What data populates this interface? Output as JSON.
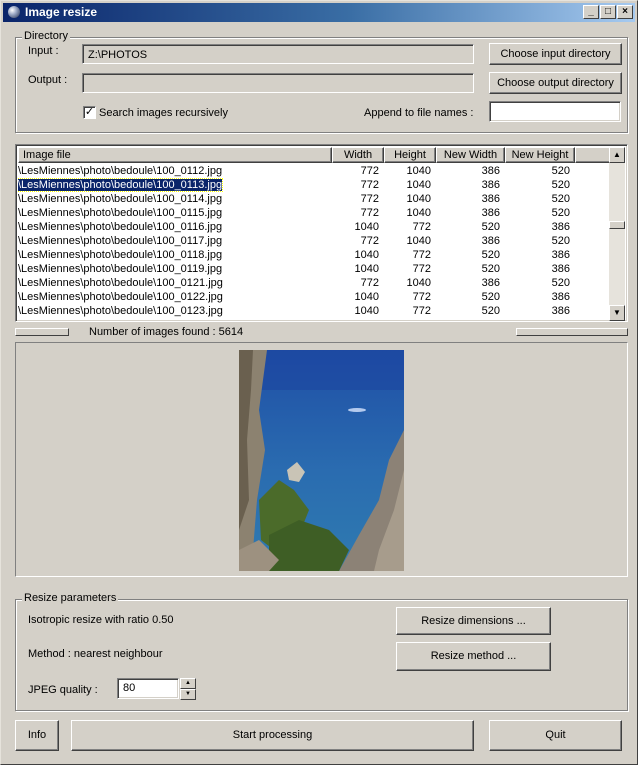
{
  "window": {
    "title": "Image resize",
    "controls": {
      "minimize": "_",
      "maximize": "□",
      "close": "×"
    }
  },
  "directory": {
    "legend": "Directory",
    "input_label": "Input :",
    "input_value": "Z:\\PHOTOS",
    "output_label": "Output :",
    "output_value": "",
    "choose_input_button": "Choose input directory",
    "choose_output_button": "Choose output directory",
    "recursive_label": "Search images recursively",
    "recursive_checked": true,
    "append_label": "Append to file names :",
    "append_value": ""
  },
  "table": {
    "columns": [
      "Image file",
      "Width",
      "Height",
      "New Width",
      "New Height"
    ],
    "rows": [
      {
        "file": "\\LesMiennes\\photo\\bedoule\\100_0112.jpg",
        "width": "772",
        "height": "1040",
        "new_width": "386",
        "new_height": "520",
        "selected": false
      },
      {
        "file": "\\LesMiennes\\photo\\bedoule\\100_0113.jpg",
        "width": "772",
        "height": "1040",
        "new_width": "386",
        "new_height": "520",
        "selected": true
      },
      {
        "file": "\\LesMiennes\\photo\\bedoule\\100_0114.jpg",
        "width": "772",
        "height": "1040",
        "new_width": "386",
        "new_height": "520",
        "selected": false
      },
      {
        "file": "\\LesMiennes\\photo\\bedoule\\100_0115.jpg",
        "width": "772",
        "height": "1040",
        "new_width": "386",
        "new_height": "520",
        "selected": false
      },
      {
        "file": "\\LesMiennes\\photo\\bedoule\\100_0116.jpg",
        "width": "1040",
        "height": "772",
        "new_width": "520",
        "new_height": "386",
        "selected": false
      },
      {
        "file": "\\LesMiennes\\photo\\bedoule\\100_0117.jpg",
        "width": "772",
        "height": "1040",
        "new_width": "386",
        "new_height": "520",
        "selected": false
      },
      {
        "file": "\\LesMiennes\\photo\\bedoule\\100_0118.jpg",
        "width": "1040",
        "height": "772",
        "new_width": "520",
        "new_height": "386",
        "selected": false
      },
      {
        "file": "\\LesMiennes\\photo\\bedoule\\100_0119.jpg",
        "width": "1040",
        "height": "772",
        "new_width": "520",
        "new_height": "386",
        "selected": false
      },
      {
        "file": "\\LesMiennes\\photo\\bedoule\\100_0121.jpg",
        "width": "772",
        "height": "1040",
        "new_width": "386",
        "new_height": "520",
        "selected": false
      },
      {
        "file": "\\LesMiennes\\photo\\bedoule\\100_0122.jpg",
        "width": "1040",
        "height": "772",
        "new_width": "520",
        "new_height": "386",
        "selected": false
      },
      {
        "file": "\\LesMiennes\\photo\\bedoule\\100_0123.jpg",
        "width": "1040",
        "height": "772",
        "new_width": "520",
        "new_height": "386",
        "selected": false
      }
    ]
  },
  "status": {
    "count_text": "Number of images found : 5614"
  },
  "resize": {
    "legend": "Resize parameters",
    "isotropic_text": "Isotropic resize with ratio 0.50",
    "method_text": "Method : nearest neighbour",
    "quality_label": "JPEG quality :",
    "quality_value": "80",
    "dimensions_button": "Resize dimensions ...",
    "method_button": "Resize method ..."
  },
  "bottom": {
    "info_button": "Info",
    "start_button": "Start processing",
    "quit_button": "Quit"
  },
  "colors": {
    "face": "#d4d0c8",
    "title_start": "#0a246a",
    "title_end": "#a6caf0",
    "selection": "#0a246a"
  },
  "icons": [
    "app-icon",
    "minimize-icon",
    "maximize-icon",
    "close-icon",
    "scroll-up-icon",
    "scroll-down-icon",
    "spin-up-icon",
    "spin-down-icon",
    "checkmark-icon"
  ]
}
